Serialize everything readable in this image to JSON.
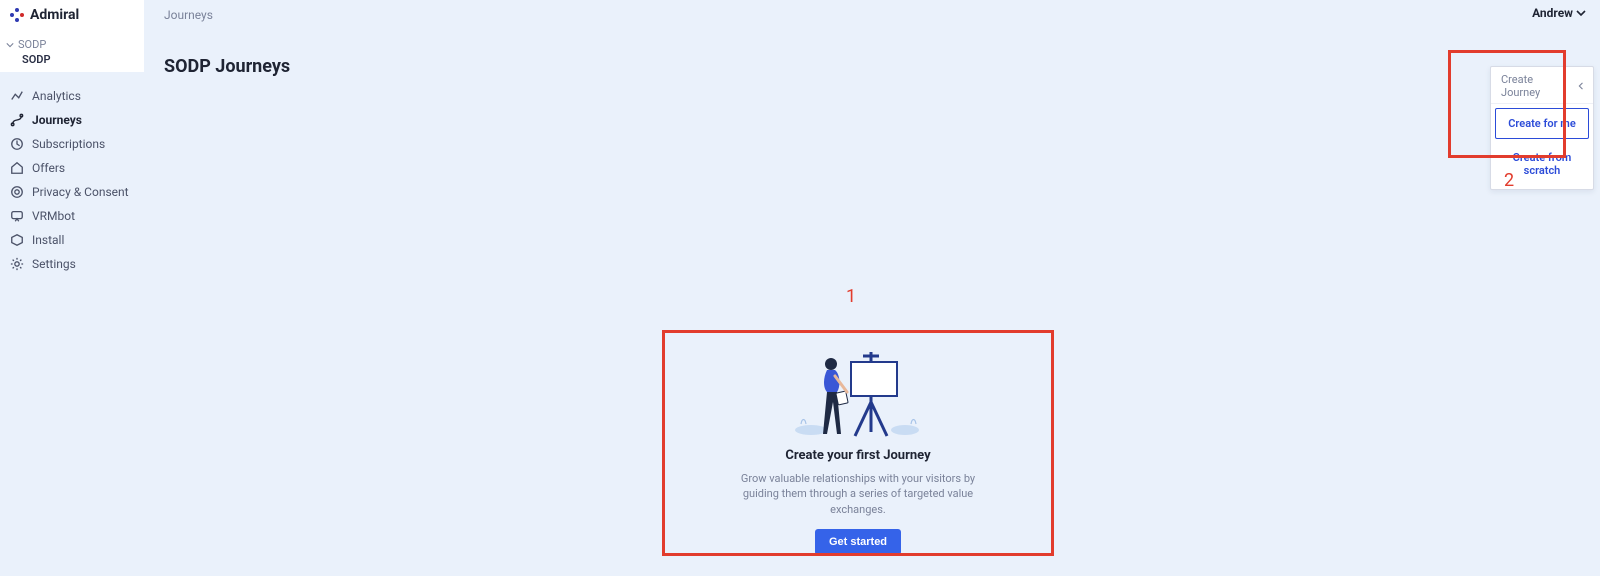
{
  "brand": {
    "name": "Admiral"
  },
  "project": {
    "parent": "SODP",
    "current": "SODP"
  },
  "sidebar": {
    "items": [
      {
        "label": "Analytics"
      },
      {
        "label": "Journeys"
      },
      {
        "label": "Subscriptions"
      },
      {
        "label": "Offers"
      },
      {
        "label": "Privacy & Consent"
      },
      {
        "label": "VRMbot"
      },
      {
        "label": "Install"
      },
      {
        "label": "Settings"
      }
    ],
    "active_index": 1
  },
  "header": {
    "breadcrumb": "Journeys",
    "user": "Andrew"
  },
  "page": {
    "title": "SODP Journeys"
  },
  "create_dropdown": {
    "head": "Create Journey",
    "opt_primary": "Create for me",
    "opt_secondary": "Create from scratch"
  },
  "empty_state": {
    "title": "Create your first Journey",
    "body": "Grow valuable relationships with your visitors by guiding them through a series of targeted value exchanges.",
    "cta": "Get started"
  },
  "annotations": {
    "one": "1",
    "two": "2"
  }
}
